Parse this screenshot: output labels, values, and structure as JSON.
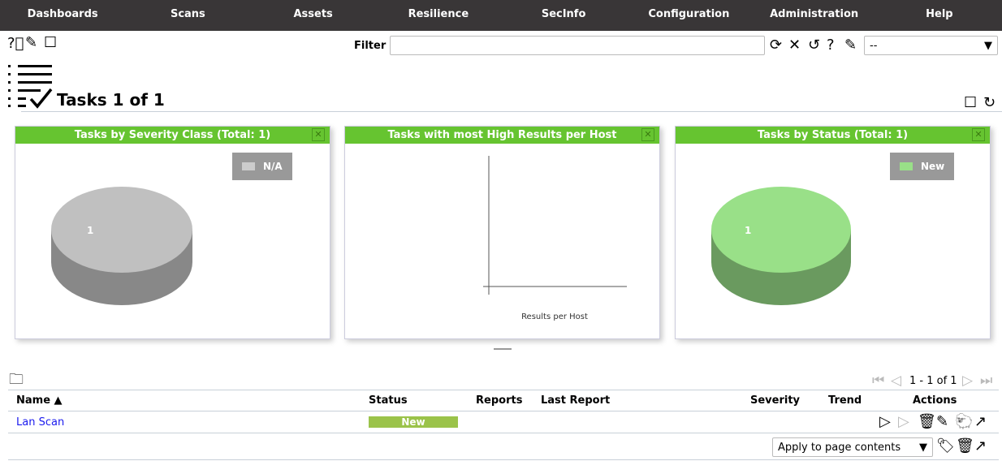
{
  "nav": [
    "Dashboards",
    "Scans",
    "Assets",
    "Resilience",
    "SecInfo",
    "Configuration",
    "Administration",
    "Help"
  ],
  "toolbar": {
    "filter_label": "Filter",
    "filter_value": "",
    "filter_select": "--"
  },
  "page": {
    "title": "Tasks 1 of 1"
  },
  "panels": [
    {
      "title": "Tasks by Severity Class (Total: 1)",
      "legend": "N/A",
      "legend_color": "#c0c0c0",
      "slice_label": "1",
      "top": "#c0c0c0",
      "side": "#888888"
    },
    {
      "title": "Tasks with most High Results per Host",
      "xlabel": "Results per Host"
    },
    {
      "title": "Tasks by Status (Total: 1)",
      "legend": "New",
      "legend_color": "#99e088",
      "slice_label": "1",
      "top": "#99e088",
      "side": "#6a9a5f"
    }
  ],
  "pagination": "1 - 1 of 1",
  "table": {
    "headers": {
      "name": "Name ▲",
      "status": "Status",
      "reports": "Reports",
      "last_report": "Last Report",
      "severity": "Severity",
      "trend": "Trend",
      "actions": "Actions"
    },
    "rows": [
      {
        "name": "Lan Scan",
        "status": "New",
        "status_color": "#9bc34a"
      }
    ]
  },
  "bulk": {
    "select": "Apply to page contents"
  }
}
